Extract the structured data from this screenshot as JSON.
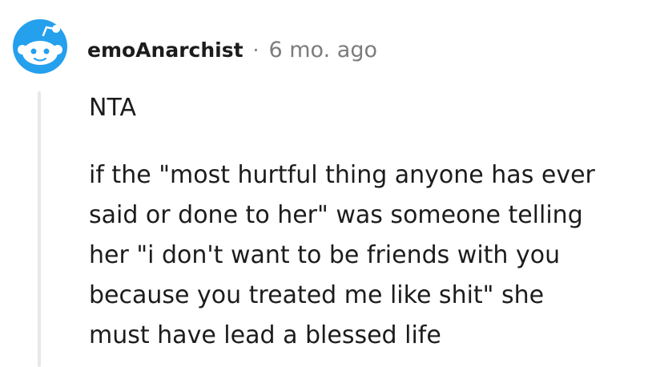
{
  "comment": {
    "author": "emoAnarchist",
    "separator": "·",
    "timestamp": "6 mo. ago",
    "avatar_icon": "reddit-snoo-avatar-icon",
    "colors": {
      "avatar_bg": "#24A0ED",
      "text": "#1C1C1C",
      "meta": "#7C7C7C",
      "thread_line": "#E6E8EA"
    },
    "body": {
      "first_paragraph": "NTA",
      "second_paragraph_lines": [
        "if the \"most hurtful thing anyone has ever",
        "said or done to her\" was someone telling",
        "her \"i don't want to be friends with you",
        "because you treated me like shit\" she",
        "must have lead a blessed life"
      ]
    }
  }
}
